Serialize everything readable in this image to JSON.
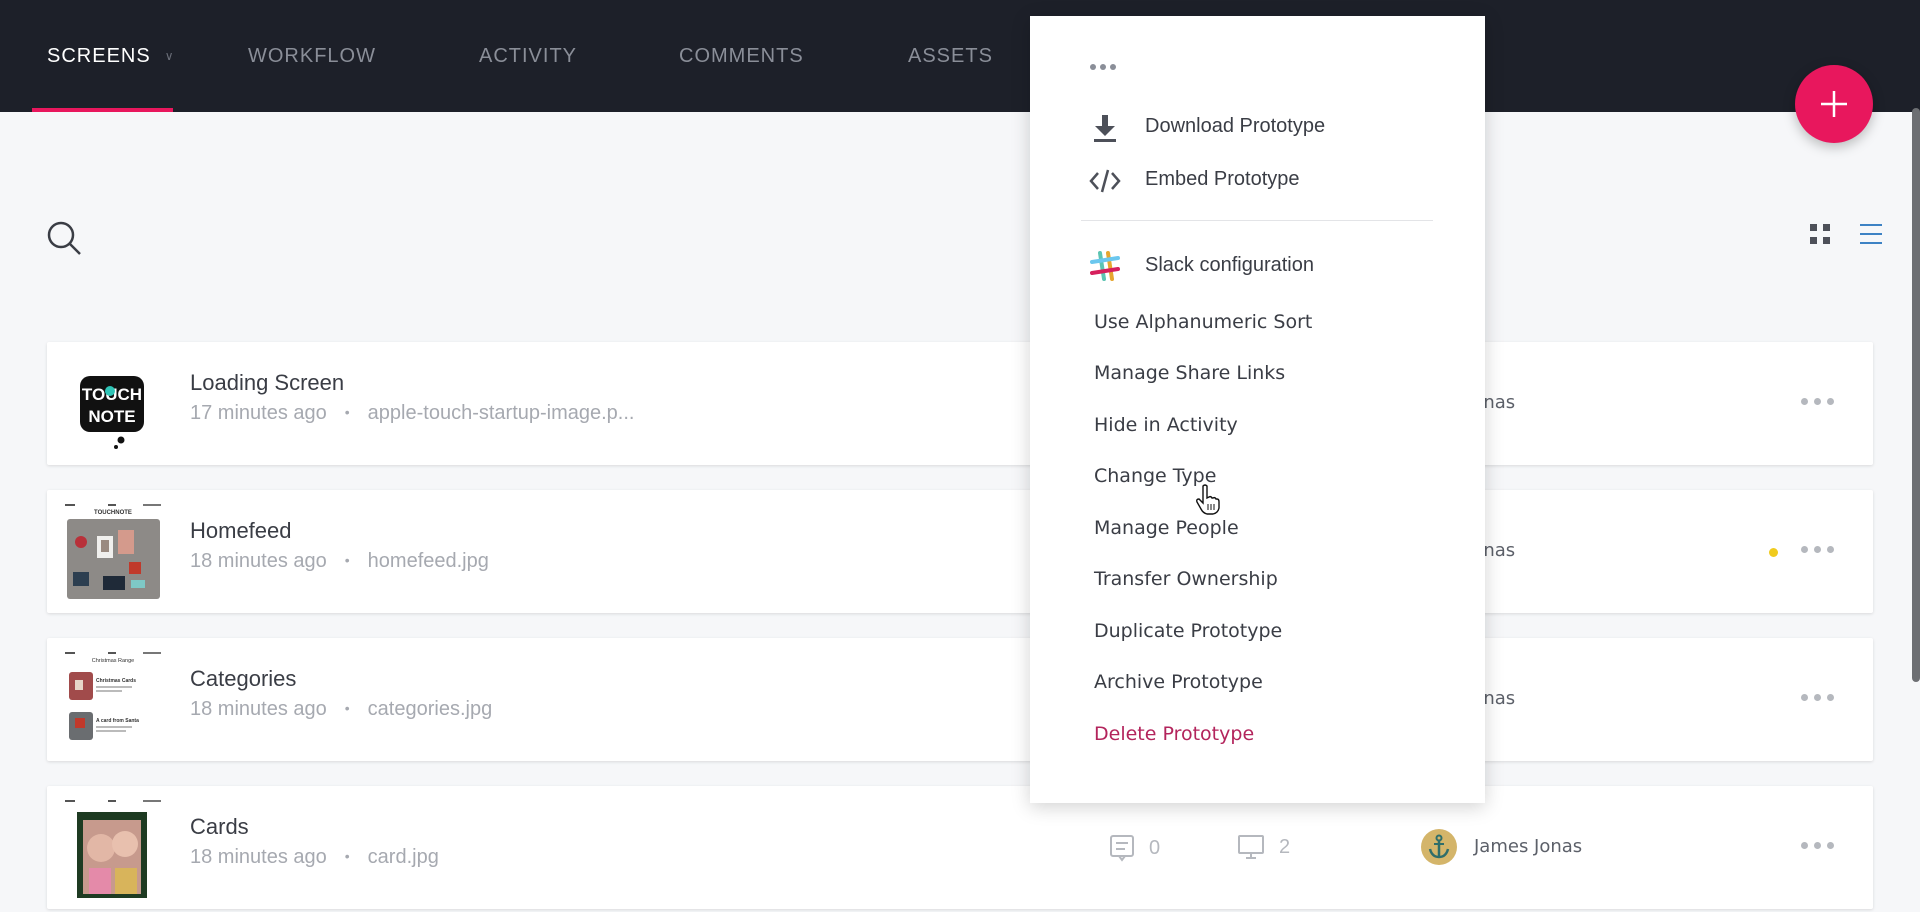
{
  "nav": {
    "tabs": [
      {
        "label": "SCREENS",
        "active": true,
        "has_dropdown": true
      },
      {
        "label": "WORKFLOW",
        "active": false
      },
      {
        "label": "ACTIVITY",
        "active": false
      },
      {
        "label": "COMMENTS",
        "active": false
      },
      {
        "label": "ASSETS",
        "active": false
      }
    ],
    "accent_color": "#e8175d",
    "add_button_icon": "plus-icon"
  },
  "toolbar": {
    "search_icon": "search-icon",
    "view_modes": [
      {
        "name": "grid",
        "icon": "grid-icon",
        "active": false
      },
      {
        "name": "list",
        "icon": "list-icon",
        "active": true
      }
    ]
  },
  "screens": [
    {
      "title": "Loading Screen",
      "time": "17 minutes ago",
      "file": "apple-touch-startup-image.p...",
      "owner": "James Jonas",
      "status_dot": false
    },
    {
      "title": "Homefeed",
      "time": "18 minutes ago",
      "file": "homefeed.jpg",
      "owner": "James Jonas",
      "status_dot": true,
      "status_color": "#f0cb1e"
    },
    {
      "title": "Categories",
      "time": "18 minutes ago",
      "file": "categories.jpg",
      "owner": "James Jonas",
      "status_dot": false
    },
    {
      "title": "Cards",
      "time": "18 minutes ago",
      "file": "card.jpg",
      "comments": "0",
      "devices": "2",
      "owner": "James Jonas",
      "status_dot": false
    }
  ],
  "thumbnail_texts": {
    "touchnote_line1": "TOUCH",
    "touchnote_line2": "NOTE",
    "homefeed_brand": "TOUCHNOTE",
    "categories_header": "Christmas Range",
    "categories_item1": "Christmas Cards",
    "categories_item2": "A card from Santa"
  },
  "menu": {
    "top_items": [
      {
        "label": "Download Prototype",
        "icon": "download-icon"
      },
      {
        "label": "Embed Prototype",
        "icon": "code-icon"
      }
    ],
    "slack_item": {
      "label": "Slack configuration",
      "icon": "slack-icon"
    },
    "items": [
      {
        "label": "Use Alphanumeric Sort"
      },
      {
        "label": "Manage Share Links"
      },
      {
        "label": "Hide in Activity"
      },
      {
        "label": "Change Type",
        "hovered": true
      },
      {
        "label": "Manage People"
      },
      {
        "label": "Transfer Ownership"
      },
      {
        "label": "Duplicate Prototype"
      },
      {
        "label": "Archive Prototype"
      }
    ],
    "danger_item": {
      "label": "Delete Prototype",
      "color": "#b3245c"
    }
  }
}
